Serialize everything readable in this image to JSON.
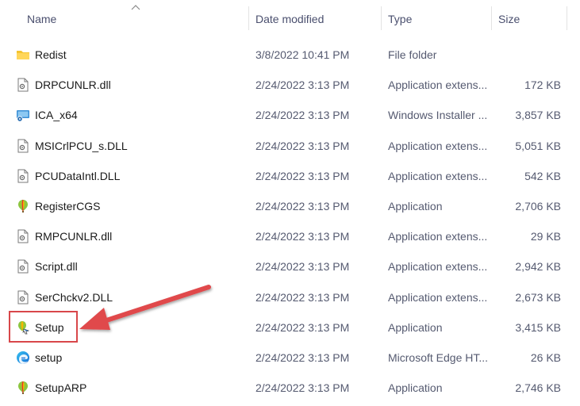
{
  "columns": {
    "name": "Name",
    "date": "Date modified",
    "type": "Type",
    "size": "Size"
  },
  "files": [
    {
      "name": "Redist",
      "date": "3/8/2022 10:41 PM",
      "type": "File folder",
      "size": "",
      "icon": "folder-icon"
    },
    {
      "name": "DRPCUNLR.dll",
      "date": "2/24/2022 3:13 PM",
      "type": "Application extens...",
      "size": "172 KB",
      "icon": "dll-file-icon"
    },
    {
      "name": "ICA_x64",
      "date": "2/24/2022 3:13 PM",
      "type": "Windows Installer ...",
      "size": "3,857 KB",
      "icon": "installer-package-icon"
    },
    {
      "name": "MSICrlPCU_s.DLL",
      "date": "2/24/2022 3:13 PM",
      "type": "Application extens...",
      "size": "5,051 KB",
      "icon": "dll-file-icon"
    },
    {
      "name": "PCUDataIntl.DLL",
      "date": "2/24/2022 3:13 PM",
      "type": "Application extens...",
      "size": "542 KB",
      "icon": "dll-file-icon"
    },
    {
      "name": "RegisterCGS",
      "date": "2/24/2022 3:13 PM",
      "type": "Application",
      "size": "2,706 KB",
      "icon": "corel-balloon-icon"
    },
    {
      "name": "RMPCUNLR.dll",
      "date": "2/24/2022 3:13 PM",
      "type": "Application extens...",
      "size": "29 KB",
      "icon": "dll-file-icon"
    },
    {
      "name": "Script.dll",
      "date": "2/24/2022 3:13 PM",
      "type": "Application extens...",
      "size": "2,942 KB",
      "icon": "dll-file-icon"
    },
    {
      "name": "SerChckv2.DLL",
      "date": "2/24/2022 3:13 PM",
      "type": "Application extens...",
      "size": "2,673 KB",
      "icon": "dll-file-icon"
    },
    {
      "name": "Setup",
      "date": "2/24/2022 3:13 PM",
      "type": "Application",
      "size": "3,415 KB",
      "icon": "corel-setup-icon"
    },
    {
      "name": "setup",
      "date": "2/24/2022 3:13 PM",
      "type": "Microsoft Edge HT...",
      "size": "26 KB",
      "icon": "edge-icon"
    },
    {
      "name": "SetupARP",
      "date": "2/24/2022 3:13 PM",
      "type": "Application",
      "size": "2,746 KB",
      "icon": "corel-balloon-icon"
    }
  ],
  "annotation": {
    "highlight_color": "#d8474a",
    "target": "Setup"
  }
}
